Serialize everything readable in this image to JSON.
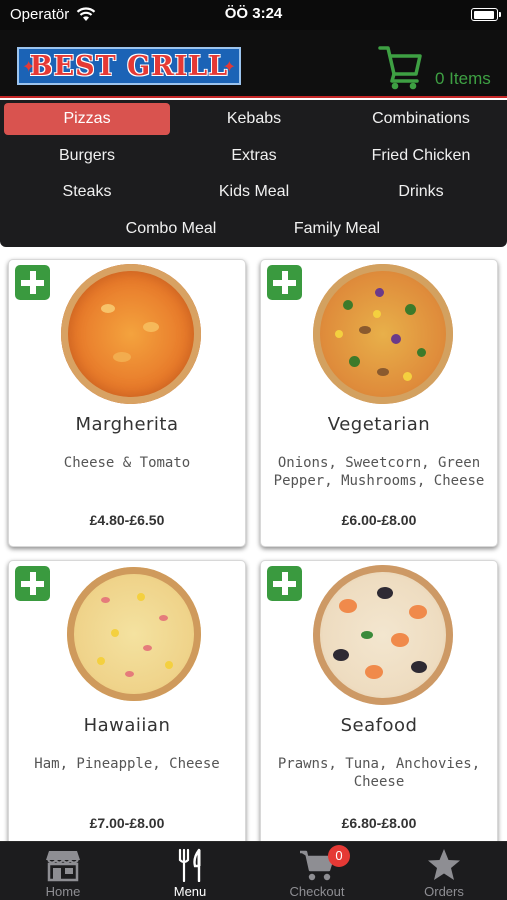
{
  "status_bar": {
    "carrier": "Operatör",
    "time": "ÖÖ 3:24"
  },
  "header": {
    "logo_text": "BEST GRILL",
    "logo_star": "✦",
    "cart_items": "0 Items"
  },
  "categories": [
    {
      "label": "Pizzas",
      "active": true
    },
    {
      "label": "Kebabs"
    },
    {
      "label": "Combinations"
    },
    {
      "label": "Burgers"
    },
    {
      "label": "Extras"
    },
    {
      "label": "Fried Chicken"
    },
    {
      "label": "Steaks"
    },
    {
      "label": "Kids Meal"
    },
    {
      "label": "Drinks"
    },
    {
      "label": "Combo Meal"
    },
    {
      "label": "Family Meal"
    }
  ],
  "products": [
    {
      "name": "Margherita",
      "description": "Cheese & Tomato",
      "price": "£4.80-£6.50",
      "icon": "pizza-margherita"
    },
    {
      "name": "Vegetarian",
      "description": "Onions, Sweetcorn, Green Pepper, Mushrooms, Cheese",
      "price": "£6.00-£8.00",
      "icon": "pizza-vegetarian"
    },
    {
      "name": "Hawaiian",
      "description": "Ham, Pineapple, Cheese",
      "price": "£7.00-£8.00",
      "icon": "pizza-hawaiian"
    },
    {
      "name": "Seafood",
      "description": "Prawns, Tuna, Anchovies, Cheese",
      "price": "£6.80-£8.00",
      "icon": "pizza-seafood"
    }
  ],
  "tabbar": {
    "tabs": [
      {
        "label": "Home",
        "icon": "store-icon"
      },
      {
        "label": "Menu",
        "icon": "fork-knife-icon",
        "active": true
      },
      {
        "label": "Checkout",
        "icon": "cart-icon",
        "badge": "0"
      },
      {
        "label": "Orders",
        "icon": "star-icon"
      }
    ]
  },
  "colors": {
    "accent_red": "#d9534f",
    "accent_green": "#3a9a3f",
    "bar_bg": "#1c1c1e"
  }
}
